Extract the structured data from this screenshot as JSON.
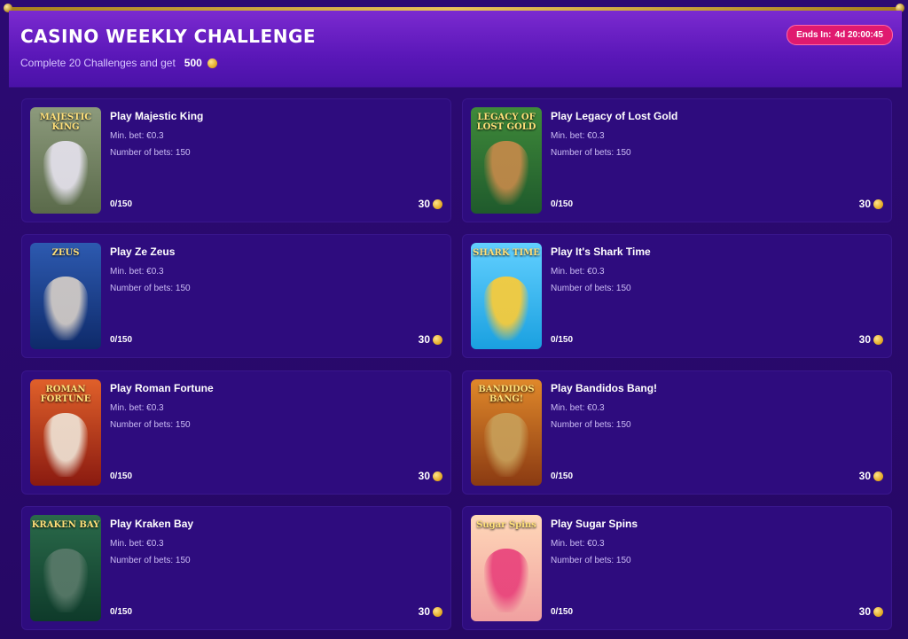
{
  "header": {
    "title": "CASINO WEEKLY CHALLENGE",
    "subtitle": "Complete 20 Challenges and get",
    "reward": "500",
    "timer_label": "Ends In:",
    "timer_value": "4d 20:00:45"
  },
  "challenges": [
    {
      "name": "Play Majestic King",
      "min_bet": "Min. bet: €0.3",
      "bets": "Number of bets: 150",
      "progress": "0/150",
      "points": "30",
      "thumb_title": "MAJESTIC KING",
      "bg": "#5a6a4a",
      "bg2": "#8c9a7c",
      "figure": "#e8e4f0"
    },
    {
      "name": "Play Legacy of Lost Gold",
      "min_bet": "Min. bet: €0.3",
      "bets": "Number of bets: 150",
      "progress": "0/150",
      "points": "30",
      "thumb_title": "LEGACY OF LOST GOLD",
      "bg": "#1f5a2c",
      "bg2": "#3f8a3a",
      "figure": "#c88a4a"
    },
    {
      "name": "Play Ze Zeus",
      "min_bet": "Min. bet: €0.3",
      "bets": "Number of bets: 150",
      "progress": "0/150",
      "points": "30",
      "thumb_title": "ZEUS",
      "bg": "#0e2a6a",
      "bg2": "#2d5ab0",
      "figure": "#d8d0c8"
    },
    {
      "name": "Play It's Shark Time",
      "min_bet": "Min. bet: €0.3",
      "bets": "Number of bets: 150",
      "progress": "0/150",
      "points": "30",
      "thumb_title": "SHARK TIME",
      "bg": "#1aa0e0",
      "bg2": "#62d0ff",
      "figure": "#ffcc33"
    },
    {
      "name": "Play Roman Fortune",
      "min_bet": "Min. bet: €0.3",
      "bets": "Number of bets: 150",
      "progress": "0/150",
      "points": "30",
      "thumb_title": "ROMAN FORTUNE",
      "bg": "#8a1a10",
      "bg2": "#e0602a",
      "figure": "#f0e6d8"
    },
    {
      "name": "Play Bandidos Bang!",
      "min_bet": "Min. bet: €0.3",
      "bets": "Number of bets: 150",
      "progress": "0/150",
      "points": "30",
      "thumb_title": "BANDIDOS BANG!",
      "bg": "#8a3a12",
      "bg2": "#e0882a",
      "figure": "#c8a05a"
    },
    {
      "name": "Play Kraken Bay",
      "min_bet": "Min. bet: €0.3",
      "bets": "Number of bets: 150",
      "progress": "0/150",
      "points": "30",
      "thumb_title": "KRAKEN BAY",
      "bg": "#0e3a2a",
      "bg2": "#2a6a4a",
      "figure": "#5a7a6a"
    },
    {
      "name": "Play Sugar Spins",
      "min_bet": "Min. bet: €0.3",
      "bets": "Number of bets: 150",
      "progress": "0/150",
      "points": "30",
      "thumb_title": "Sugar Spins",
      "bg": "#f0a0a0",
      "bg2": "#ffd8b8",
      "figure": "#e8407a"
    }
  ]
}
